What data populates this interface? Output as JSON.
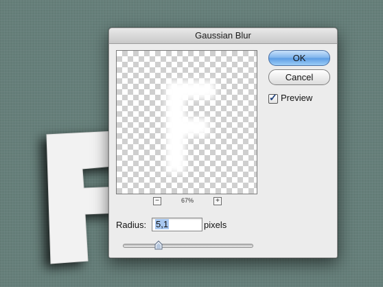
{
  "dialog": {
    "title": "Gaussian Blur",
    "ok_label": "OK",
    "cancel_label": "Cancel",
    "preview_label": "Preview",
    "preview_checked": true,
    "zoom": {
      "minus_label": "−",
      "level": "67%",
      "plus_label": "+"
    },
    "radius": {
      "label": "Radius:",
      "value": "5,1",
      "unit": "pixels",
      "slider_fraction": 0.27
    }
  },
  "colors": {
    "background": "#667f7a",
    "dialog": "#ececec",
    "ok_button": "#7fb4ec"
  },
  "icons": {
    "preview_glyph": "letter-F-blurred",
    "background_glyph": "letter-F-3d"
  }
}
